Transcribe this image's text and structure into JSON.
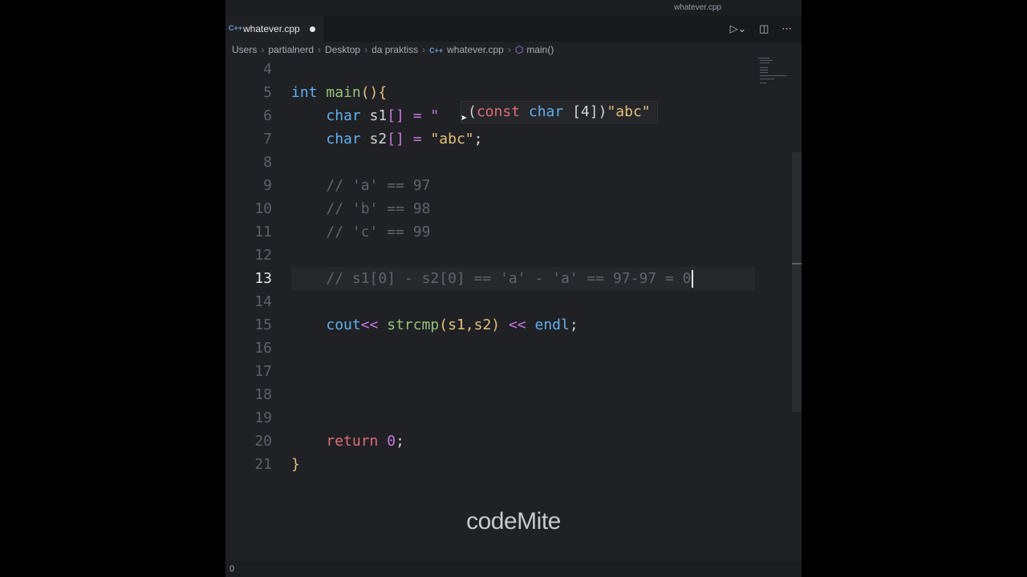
{
  "window": {
    "title": "whatever.cpp"
  },
  "tab": {
    "lang_badge": "C++",
    "file_name": "whatever.cpp"
  },
  "toolbar_icons": [
    "run-icon",
    "split-editor-icon",
    "more-icon"
  ],
  "breadcrumb": {
    "items": [
      "Users",
      "partialnerd",
      "Desktop",
      "da praktiss"
    ],
    "file_badge": "C++",
    "file": "whatever.cpp",
    "symbol": "main()"
  },
  "editor": {
    "active_line": "13",
    "lines": [
      {
        "num": "4"
      },
      {
        "num": "5"
      },
      {
        "num": "6"
      },
      {
        "num": "7"
      },
      {
        "num": "8"
      },
      {
        "num": "9"
      },
      {
        "num": "10"
      },
      {
        "num": "11"
      },
      {
        "num": "12"
      },
      {
        "num": "13"
      },
      {
        "num": "14"
      },
      {
        "num": "15"
      },
      {
        "num": "16"
      },
      {
        "num": "17"
      },
      {
        "num": "18"
      },
      {
        "num": "19"
      },
      {
        "num": "20"
      },
      {
        "num": "21"
      }
    ],
    "tokens": {
      "l5_int": "int",
      "l5_main": "main",
      "l5_paren": "(){",
      "l6_char": "char",
      "l6_s1": "s1",
      "l6_rest": "[] = \"",
      "l7_char": "char",
      "l7_s2": "s2",
      "l7_eq": "[] = ",
      "l7_str": "\"abc\"",
      "l7_semi": ";",
      "l9": "// 'a' == 97",
      "l10": "// 'b' == 98",
      "l11": "// 'c' == 99",
      "l13": "// s1[0] - s2[0] == 'a' - 'a' == 97-97 = 0",
      "l15_cout": "cout",
      "l15_op1": "<< ",
      "l15_fn": "strcmp",
      "l15_args": "(s1,s2)",
      "l15_op2": " << ",
      "l15_endl": "endl",
      "l15_semi": ";",
      "l20_ret": "return",
      "l20_zero": "0",
      "l20_semi": ";",
      "l21": "}"
    }
  },
  "hover": {
    "open": "(",
    "kw": "const",
    "type": "char",
    "dims": "[4])",
    "value": "\"abc\""
  },
  "watermark": "codeMite",
  "status": {
    "left": "0"
  }
}
